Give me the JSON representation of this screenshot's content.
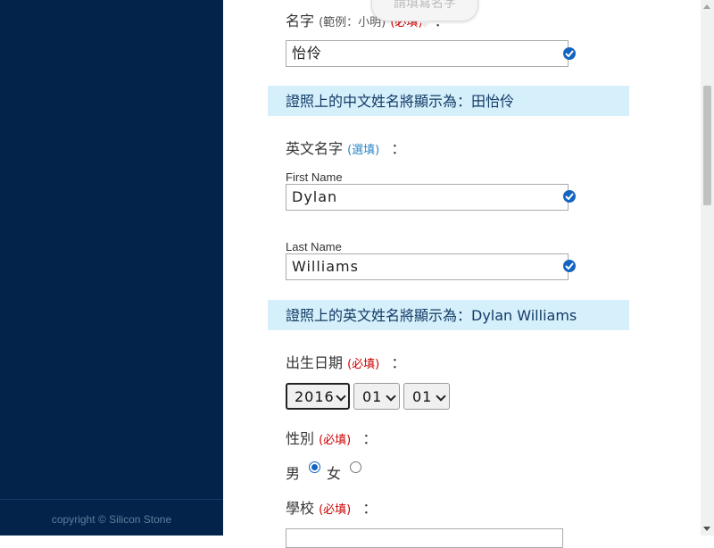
{
  "footer": {
    "copyright": "copyright © Silicon Stone"
  },
  "tooltip": {
    "text": "請填寫名字"
  },
  "first_name_zh": {
    "label": "名字",
    "example": "(範例：小明)",
    "required": "(必填)",
    "colon": "：",
    "value": "怡伶"
  },
  "banner_zh": {
    "text": "證照上的中文姓名將顯示為：田怡伶"
  },
  "english_name": {
    "label": "英文名字",
    "optional": "(選填)",
    "colon": "：",
    "first_label": "First Name",
    "first_value": "Dylan",
    "last_label": "Last Name",
    "last_value": "Williams"
  },
  "banner_en": {
    "text": "證照上的英文姓名將顯示為：Dylan Williams"
  },
  "birthday": {
    "label": "出生日期",
    "required": "(必填)",
    "colon": "：",
    "year": "2016",
    "month": "01",
    "day": "01"
  },
  "gender": {
    "label": "性別",
    "required": "(必填)",
    "colon": "：",
    "male": "男",
    "female": "女",
    "selected": "男"
  },
  "school": {
    "label": "學校",
    "required": "(必填)",
    "colon": "："
  },
  "colors": {
    "sidebar": "#03234a",
    "banner": "#d6f0fb",
    "required": "#cc0000",
    "optional": "#2a86c8",
    "check": "#1565c0"
  }
}
